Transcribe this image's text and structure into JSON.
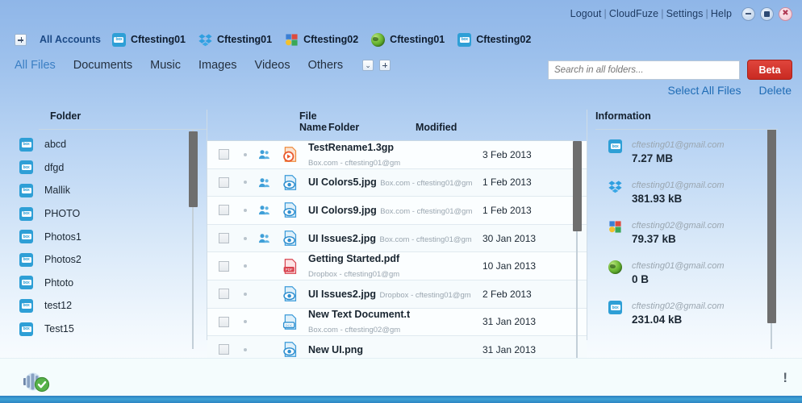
{
  "window": {
    "topnav": [
      "Logout",
      "CloudFuze",
      "Settings",
      "Help"
    ],
    "controls": [
      {
        "name": "minimize",
        "glyph": "minimize-icon"
      },
      {
        "name": "maximize",
        "glyph": "maximize-icon"
      },
      {
        "name": "close",
        "glyph": "close-icon"
      }
    ]
  },
  "accounts": {
    "add_label": "+",
    "all_accounts_label": "All Accounts",
    "items": [
      {
        "label": "Cftesting01",
        "provider": "box"
      },
      {
        "label": "Cftesting01",
        "provider": "dropbox"
      },
      {
        "label": "Cftesting02",
        "provider": "gdocs"
      },
      {
        "label": "Cftesting01",
        "provider": "globe"
      },
      {
        "label": "Cftesting02",
        "provider": "box"
      }
    ]
  },
  "filters": {
    "tabs": [
      {
        "label": "All Files",
        "active": true
      },
      {
        "label": "Documents",
        "active": false
      },
      {
        "label": "Music",
        "active": false
      },
      {
        "label": "Images",
        "active": false
      },
      {
        "label": "Videos",
        "active": false
      },
      {
        "label": "Others",
        "active": false
      }
    ],
    "dropdown_glyph": "⌄",
    "add_glyph": "+"
  },
  "search": {
    "placeholder": "Search in all folders...",
    "value": "",
    "beta_label": "Beta"
  },
  "actions": {
    "select_all": "Select All Files",
    "delete": "Delete"
  },
  "folder_panel": {
    "title": "Folder",
    "items": [
      {
        "label": "abcd",
        "provider": "box"
      },
      {
        "label": "dfgd",
        "provider": "box"
      },
      {
        "label": "Mallik",
        "provider": "box"
      },
      {
        "label": "PHOTO",
        "provider": "box"
      },
      {
        "label": "Photos1",
        "provider": "box"
      },
      {
        "label": "Photos2",
        "provider": "box"
      },
      {
        "label": "Phtoto",
        "provider": "box"
      },
      {
        "label": "test12",
        "provider": "box"
      },
      {
        "label": "Test15",
        "provider": "box"
      }
    ]
  },
  "file_panel": {
    "columns": {
      "file_name": "File Name",
      "folder": "Folder",
      "modified": "Modified"
    },
    "rows": [
      {
        "name": "TestRename1.3gp",
        "source": "Box.com - cftesting01@gm",
        "folder": "",
        "modified": "3 Feb 2013",
        "type": "video",
        "shared": true,
        "checked": false
      },
      {
        "name": "UI Colors5.jpg",
        "source": "Box.com - cftesting01@gm",
        "folder": "",
        "modified": "1 Feb 2013",
        "type": "image",
        "shared": true,
        "checked": false
      },
      {
        "name": "UI Colors9.jpg",
        "source": "Box.com - cftesting01@gm",
        "folder": "",
        "modified": "1 Feb 2013",
        "type": "image",
        "shared": true,
        "checked": false
      },
      {
        "name": "UI Issues2.jpg",
        "source": "Box.com - cftesting01@gm",
        "folder": "",
        "modified": "30 Jan 2013",
        "type": "image",
        "shared": true,
        "checked": false
      },
      {
        "name": "Getting Started.pdf",
        "source": "Dropbox - cftesting01@gm",
        "folder": "",
        "modified": "10 Jan 2013",
        "type": "pdf",
        "shared": false,
        "checked": false
      },
      {
        "name": "UI Issues2.jpg",
        "source": "Dropbox - cftesting01@gm",
        "folder": "",
        "modified": "2 Feb 2013",
        "type": "image",
        "shared": false,
        "checked": false
      },
      {
        "name": "New Text Document.t",
        "source": "Box.com - cftesting02@gm",
        "folder": "",
        "modified": "31 Jan 2013",
        "type": "doc",
        "shared": false,
        "checked": false
      },
      {
        "name": "New UI.png",
        "source": "",
        "folder": "",
        "modified": "31 Jan 2013",
        "type": "image",
        "shared": false,
        "checked": false
      }
    ]
  },
  "info_panel": {
    "title": "Information",
    "rows": [
      {
        "email": "cftesting01@gmail.com",
        "size": "7.27 MB",
        "provider": "box"
      },
      {
        "email": "cftesting01@gmail.com",
        "size": "381.93 kB",
        "provider": "dropbox"
      },
      {
        "email": "cftesting02@gmail.com",
        "size": "79.37 kB",
        "provider": "gdocs"
      },
      {
        "email": "cftesting01@gmail.com",
        "size": "0  B",
        "provider": "globe"
      },
      {
        "email": "cftesting02@gmail.com",
        "size": "231.04 kB",
        "provider": "box"
      }
    ]
  },
  "statusbar": {
    "sync_icon": "sync-ok-icon",
    "alert_glyph": "!"
  },
  "colors": {
    "accent_blue": "#1f6cb5",
    "beta_red": "#c92a22",
    "box_blue": "#2e9fd6",
    "dropbox_blue": "#3aa3e3",
    "bottom_bar": "#2c84c2"
  }
}
